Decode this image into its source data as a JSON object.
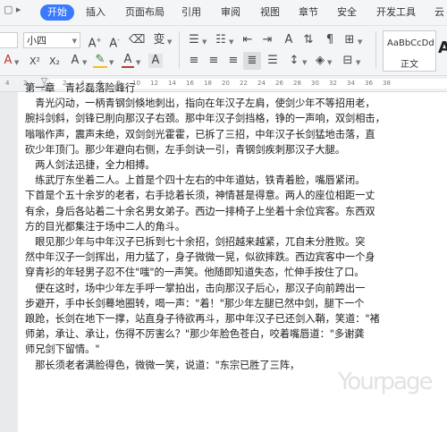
{
  "menu": {
    "left_icons": "▢ ▸",
    "items": [
      "开始",
      "插入",
      "页面布局",
      "引用",
      "审阅",
      "视图",
      "章节",
      "安全",
      "开发工具",
      "云"
    ],
    "active_index": 0
  },
  "ribbon": {
    "font_name": "",
    "font_size": "小四",
    "style_sample": "AaBbCcDd",
    "style_name": "正文",
    "style_more": "A"
  },
  "ruler": {
    "ticks": [
      "4",
      "2",
      "2",
      "4",
      "6",
      "8",
      "10",
      "12",
      "14",
      "16",
      "18",
      "20",
      "22",
      "24",
      "26",
      "28",
      "30",
      "32",
      "34",
      "36",
      "38"
    ]
  },
  "document": {
    "paragraphs": [
      "第一章　青衫磊落险峰行",
      "　青光闪动，一柄青钢剑倏地刺出，指向在年汉子左肩，使剑少年不等招用老，",
      "腕抖剑斜，剑锋已削向那汉子右颈。那中年汉子剑挡格，铮的一声响，双剑相击，",
      "嗡嗡作声，震声未绝，双剑剑光霍霍，已拆了三招，中年汉子长剑猛地击落，直",
      "砍少年顶门。那少年避向右侧，左手剑诀一引，青钢剑疾刺那汉子大腿。",
      "　两人剑法迅捷，全力相搏。",
      "　练武厅东坐着二人。上首是个四十左右的中年道姑，铁青着脸，嘴唇紧闭。",
      "下首是个五十余岁的老者，右手捻着长须，神情甚是得意。两人的座位相距一丈",
      "有余，身后各站着二十余名男女弟子。西边一排椅子上坐着十余位宾客。东西双",
      "方的目光都集注于场中二人的角斗。",
      "　眼见那少年与中年汉子已拆到七十余招，剑招越来越紧，兀自未分胜败。突",
      "然中年汉子一剑挥出，用力猛了，身子微微一晃，似欲摔跌。西边宾客中一个身",
      "穿青衫的年轻男子忍不住\"嗤\"的一声笑。他随即知道失态，忙伸手按住了口。",
      "　便在这时，场中少年左手呼一掌拍出，击向那汉子后心，那汉子向前跨出一",
      "步避开，手中长剑蓦地圈转，喝一声：\"着！\"那少年左腿已然中剑，腿下一个",
      "踉跄，长剑在地下一撑，站直身子待欲再斗，那中年汉子已还剑入鞘，笑道：\"褚",
      "师弟，承让、承让，伤得不厉害么？\"那少年脸色苍白，咬着嘴唇道：\"多谢龚",
      "师兄剑下留情。\"",
      "　那长须老者满脸得色，微微一笑，说道：\"东宗已胜了三阵，"
    ]
  },
  "watermark": "Yourpage"
}
